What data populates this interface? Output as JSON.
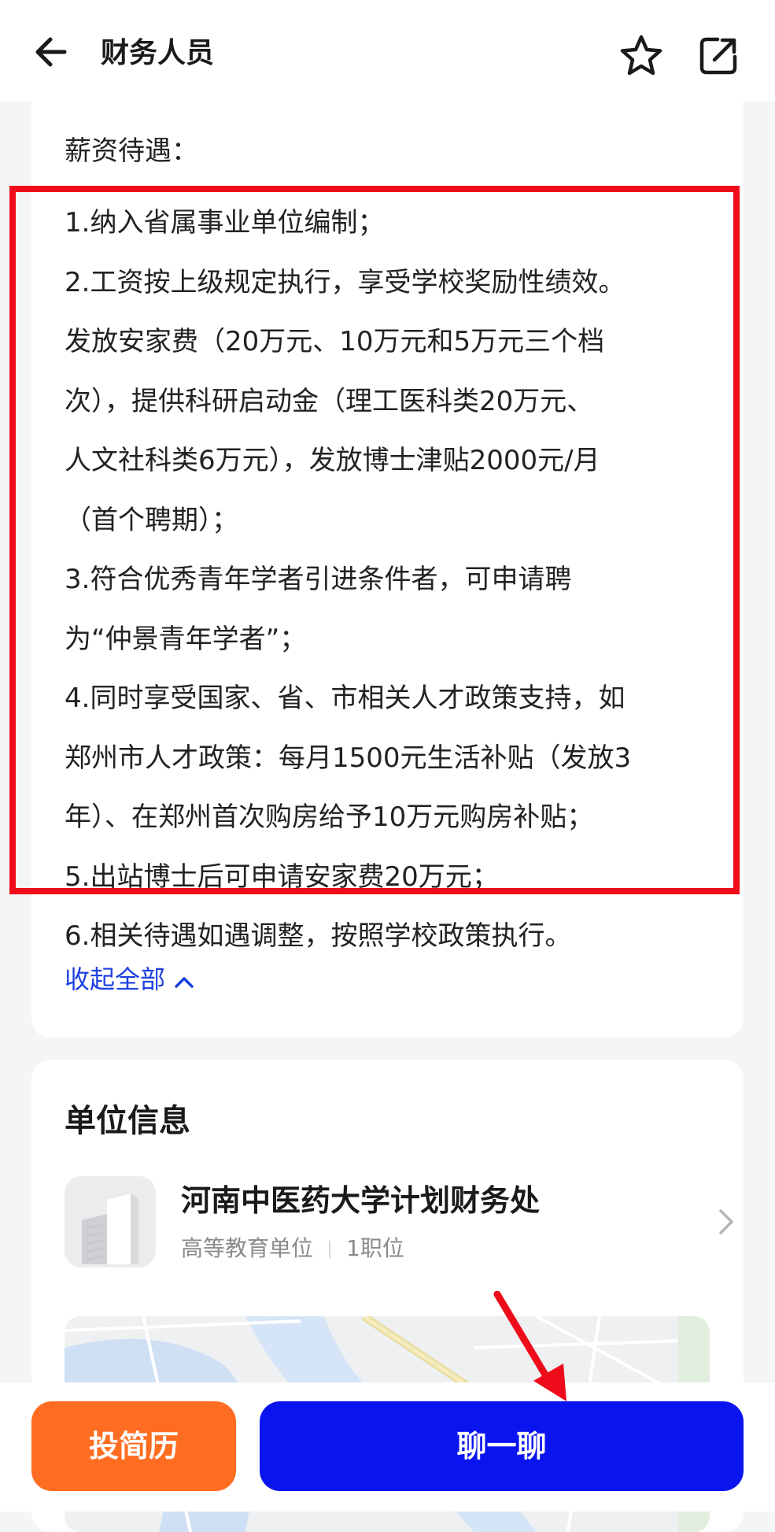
{
  "header": {
    "title": "财务人员",
    "back_icon": "arrow-left-icon",
    "favorite_icon": "star-icon",
    "share_icon": "share-icon"
  },
  "salary": {
    "heading": "薪资待遇：",
    "lines": [
      "1.纳入省属事业单位编制；",
      "2.工资按上级规定执行，享受学校奖励性绩效。",
      "发放安家费（20万元、10万元和5万元三个档",
      "次），提供科研启动金（理工医科类20万元、",
      "人文社科类6万元），发放博士津贴2000元/月",
      "（首个聘期）；",
      "3.符合优秀青年学者引进条件者，可申请聘",
      "为“仲景青年学者”；",
      "4.同时享受国家、省、市相关人才政策支持，如",
      "郑州市人才政策：每月1500元生活补贴（发放3",
      "年）、在郑州首次购房给予10万元购房补贴；",
      "5.出站博士后可申请安家费20万元；",
      "6.相关待遇如遇调整，按照学校政策执行。"
    ],
    "collapse_label": "收起全部"
  },
  "unit": {
    "heading": "单位信息",
    "name": "河南中医药大学计划财务处",
    "type": "高等教育单位",
    "positions": "1职位"
  },
  "bottom": {
    "resume_label": "投简历",
    "chat_label": "聊一聊"
  },
  "colors": {
    "accent_blue": "#0a14ee",
    "link_blue": "#1c3fdf",
    "orange": "#ff6d22",
    "highlight_red": "#ee0b1a"
  }
}
